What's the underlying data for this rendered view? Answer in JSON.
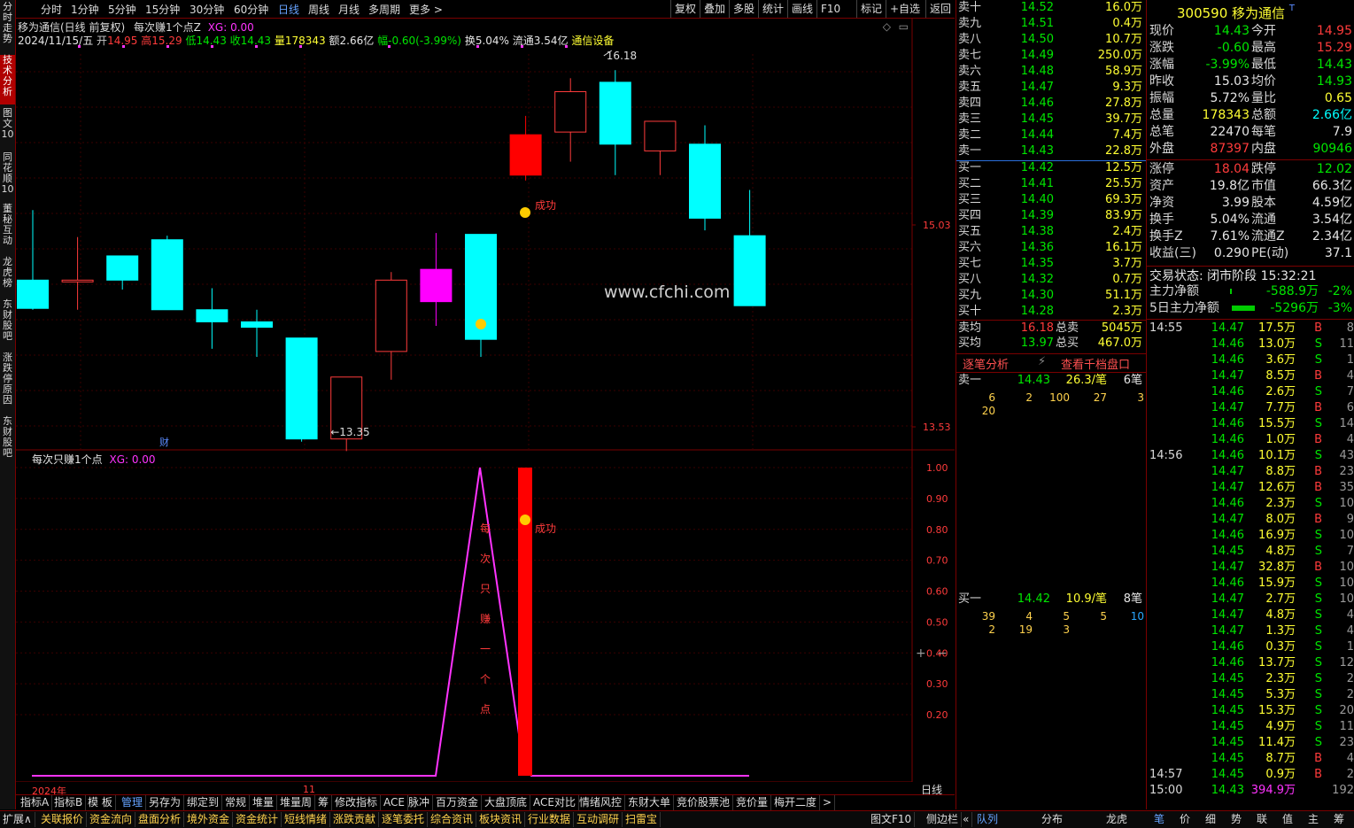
{
  "vtabs": [
    "分时走势",
    "技术分析",
    "图文10",
    "同花顺10",
    "董秘互动",
    "龙虎榜",
    "东财股吧",
    "涨跌停原因",
    "东财股吧"
  ],
  "topbar": {
    "periods": [
      "分时",
      "1分钟",
      "5分钟",
      "15分钟",
      "30分钟",
      "60分钟",
      "日线",
      "周线",
      "月线",
      "多周期",
      "更多 >"
    ],
    "active_period": "日线",
    "right_buttons": [
      "复权",
      "叠加",
      "多股",
      "统计",
      "画线",
      "F10",
      "标记",
      "+自选",
      "返回"
    ]
  },
  "chart_header": {
    "title": "移为通信(日线 前复权)",
    "indicator": "每次赚1个点Z",
    "xg": "XG: 0.00",
    "date": "2024/11/15/五",
    "open_label": "开",
    "open": "14.95",
    "high_label": "高",
    "high": "15.29",
    "low_label": "低",
    "low": "14.43",
    "close_label": "收",
    "close": "14.43",
    "vol_label": "量",
    "vol": "178343",
    "amt_label": "额",
    "amt": "2.66亿",
    "chg_label": "幅",
    "chg": "-0.60(-3.99%)",
    "turn_label": "换",
    "turn": "5.04%",
    "float_label": "流通",
    "float": "3.54亿",
    "sector": "通信设备"
  },
  "chart_data": {
    "type": "candlestick",
    "price_axis": {
      "ticks": [
        "15.03",
        "13.53"
      ]
    },
    "candles": [
      {
        "o": 14.62,
        "h": 15.14,
        "l": 14.4,
        "c": 14.41
      },
      {
        "o": 14.62,
        "h": 14.94,
        "l": 14.4,
        "c": 14.62
      },
      {
        "o": 14.8,
        "h": 14.8,
        "l": 14.55,
        "c": 14.62
      },
      {
        "o": 14.92,
        "h": 14.95,
        "l": 14.4,
        "c": 14.4
      },
      {
        "o": 14.4,
        "h": 14.56,
        "l": 14.11,
        "c": 14.31
      },
      {
        "o": 14.31,
        "h": 14.4,
        "l": 14.05,
        "c": 14.27
      },
      {
        "o": 14.19,
        "h": 14.19,
        "l": 13.42,
        "c": 13.44
      },
      {
        "o": 13.44,
        "h": 13.9,
        "l": 13.35,
        "c": 13.9
      },
      {
        "o": 14.09,
        "h": 14.68,
        "l": 13.88,
        "c": 14.62
      },
      {
        "o": 14.7,
        "h": 14.97,
        "l": 14.28,
        "c": 14.46
      },
      {
        "o": 14.96,
        "h": 14.96,
        "l": 14.05,
        "c": 14.18
      },
      {
        "o": 15.4,
        "h": 15.84,
        "l": 15.36,
        "c": 15.7
      },
      {
        "o": 15.72,
        "h": 16.12,
        "l": 15.5,
        "c": 16.02
      },
      {
        "o": 16.09,
        "h": 16.18,
        "l": 15.4,
        "c": 15.63
      },
      {
        "o": 15.58,
        "h": 15.6,
        "l": 15.4,
        "c": 15.8
      },
      {
        "o": 15.63,
        "h": 15.77,
        "l": 14.99,
        "c": 15.08
      },
      {
        "o": 14.95,
        "h": 15.29,
        "l": 14.43,
        "c": 14.43
      }
    ],
    "high_mark": "16.18",
    "low_mark": "13.35",
    "success_label": "成功",
    "watermark": "www.cfchi.com",
    "fin_badge": "财",
    "sub": {
      "title": "每次只赚1个点",
      "xg": "XG: 0.00",
      "y_ticks": [
        "1.00",
        "0.90",
        "0.80",
        "0.70",
        "0.60",
        "0.50",
        "0.40",
        "0.30",
        "0.20"
      ],
      "vertical_text": [
        "每",
        "次",
        "只",
        "赚",
        "一",
        "个",
        "点"
      ],
      "success_label": "成功"
    },
    "x_labels": [
      "2024年",
      "11"
    ],
    "period_label": "日线"
  },
  "quote": {
    "code": "300590",
    "name": "移为通信",
    "asks": [
      {
        "l": "卖十",
        "p": "14.52",
        "v": "16.0万"
      },
      {
        "l": "卖九",
        "p": "14.51",
        "v": "0.4万"
      },
      {
        "l": "卖八",
        "p": "14.50",
        "v": "10.7万"
      },
      {
        "l": "卖七",
        "p": "14.49",
        "v": "250.0万"
      },
      {
        "l": "卖六",
        "p": "14.48",
        "v": "58.9万"
      },
      {
        "l": "卖五",
        "p": "14.47",
        "v": "9.3万"
      },
      {
        "l": "卖四",
        "p": "14.46",
        "v": "27.8万"
      },
      {
        "l": "卖三",
        "p": "14.45",
        "v": "39.7万"
      },
      {
        "l": "卖二",
        "p": "14.44",
        "v": "7.4万"
      },
      {
        "l": "卖一",
        "p": "14.43",
        "v": "22.8万"
      }
    ],
    "bids": [
      {
        "l": "买一",
        "p": "14.42",
        "v": "12.5万"
      },
      {
        "l": "买二",
        "p": "14.41",
        "v": "25.5万"
      },
      {
        "l": "买三",
        "p": "14.40",
        "v": "69.3万"
      },
      {
        "l": "买四",
        "p": "14.39",
        "v": "83.9万"
      },
      {
        "l": "买五",
        "p": "14.38",
        "v": "2.4万"
      },
      {
        "l": "买六",
        "p": "14.36",
        "v": "16.1万"
      },
      {
        "l": "买七",
        "p": "14.35",
        "v": "3.7万"
      },
      {
        "l": "买八",
        "p": "14.32",
        "v": "0.7万"
      },
      {
        "l": "买九",
        "p": "14.30",
        "v": "51.1万"
      },
      {
        "l": "买十",
        "p": "14.28",
        "v": "2.3万"
      }
    ],
    "avg": [
      {
        "l": "卖均",
        "p": "16.18",
        "l2": "总卖",
        "v": "5045万"
      },
      {
        "l": "买均",
        "p": "13.97",
        "l2": "总买",
        "v": "467.0万"
      }
    ],
    "tick_analysis": "逐笔分析",
    "queue_link": "查看千档盘口",
    "sell1_queue": {
      "label": "卖一",
      "price": "14.43",
      "avg": "26.3/笔",
      "count": "6笔",
      "rows": [
        [
          "6",
          "2",
          "100",
          "27",
          "3"
        ],
        [
          "20"
        ]
      ]
    },
    "buy1_queue": {
      "label": "买一",
      "price": "14.42",
      "avg": "10.9/笔",
      "count": "8笔",
      "rows": [
        [
          "39",
          "4",
          "5",
          "5",
          "10"
        ],
        [
          "2",
          "19",
          "3"
        ]
      ]
    },
    "stats": [
      {
        "a": "现价",
        "av": "14.43",
        "b": "今开",
        "bv": "14.95",
        "ac": "grn",
        "bc": "red"
      },
      {
        "a": "涨跌",
        "av": "-0.60",
        "b": "最高",
        "bv": "15.29",
        "ac": "grn",
        "bc": "red"
      },
      {
        "a": "涨幅",
        "av": "-3.99%",
        "b": "最低",
        "bv": "14.43",
        "ac": "grn",
        "bc": "grn"
      },
      {
        "a": "昨收",
        "av": "15.03",
        "b": "均价",
        "bv": "14.93",
        "ac": "wht",
        "bc": "grn"
      },
      {
        "a": "振幅",
        "av": "5.72%",
        "b": "量比",
        "bv": "0.65",
        "ac": "wht",
        "bc": "yel"
      },
      {
        "a": "总量",
        "av": "178343",
        "b": "总额",
        "bv": "2.66亿",
        "ac": "yel",
        "bc": "cyan"
      },
      {
        "a": "总笔",
        "av": "22470",
        "b": "每笔",
        "bv": "7.9",
        "ac": "wht",
        "bc": "wht"
      },
      {
        "a": "外盘",
        "av": "87397",
        "b": "内盘",
        "bv": "90946",
        "ac": "red",
        "bc": "grn"
      }
    ],
    "stats2": [
      {
        "a": "涨停",
        "av": "18.04",
        "b": "跌停",
        "bv": "12.02",
        "ac": "red",
        "bc": "grn"
      },
      {
        "a": "资产",
        "av": "19.8亿",
        "b": "市值",
        "bv": "66.3亿",
        "ac": "wht",
        "bc": "wht"
      },
      {
        "a": "净资",
        "av": "3.99",
        "b": "股本",
        "bv": "4.59亿",
        "ac": "wht",
        "bc": "wht"
      },
      {
        "a": "换手",
        "av": "5.04%",
        "b": "流通",
        "bv": "3.54亿",
        "ac": "wht",
        "bc": "wht"
      },
      {
        "a": "换手Z",
        "av": "7.61%",
        "b": "流通Z",
        "bv": "2.34亿",
        "ac": "wht",
        "bc": "wht"
      },
      {
        "a": "收益(三)",
        "av": "0.290",
        "b": "PE(动)",
        "bv": "37.1",
        "ac": "wht",
        "bc": "wht"
      }
    ],
    "trade_status_label": "交易状态:",
    "trade_status": "闭市阶段 15:32:21",
    "net_flow": [
      {
        "l": "主力净额",
        "v": "-588.9万",
        "p": "-2%"
      },
      {
        "l": "5日主力净额",
        "v": "-5296万",
        "p": "-3%"
      }
    ]
  },
  "ticks": [
    {
      "t": "14:55",
      "p": "14.47",
      "v": "17.5万",
      "s": "B",
      "n": "8"
    },
    {
      "t": "",
      "p": "14.46",
      "v": "13.0万",
      "s": "S",
      "n": "11"
    },
    {
      "t": "",
      "p": "14.46",
      "v": "3.6万",
      "s": "S",
      "n": "1"
    },
    {
      "t": "",
      "p": "14.47",
      "v": "8.5万",
      "s": "B",
      "n": "4"
    },
    {
      "t": "",
      "p": "14.46",
      "v": "2.6万",
      "s": "S",
      "n": "7"
    },
    {
      "t": "",
      "p": "14.47",
      "v": "7.7万",
      "s": "B",
      "n": "6"
    },
    {
      "t": "",
      "p": "14.46",
      "v": "15.5万",
      "s": "S",
      "n": "14"
    },
    {
      "t": "",
      "p": "14.46",
      "v": "1.0万",
      "s": "B",
      "n": "4"
    },
    {
      "t": "14:56",
      "p": "14.46",
      "v": "10.1万",
      "s": "S",
      "n": "43"
    },
    {
      "t": "",
      "p": "14.47",
      "v": "8.8万",
      "s": "B",
      "n": "23"
    },
    {
      "t": "",
      "p": "14.47",
      "v": "12.6万",
      "s": "B",
      "n": "35"
    },
    {
      "t": "",
      "p": "14.46",
      "v": "2.3万",
      "s": "S",
      "n": "10"
    },
    {
      "t": "",
      "p": "14.47",
      "v": "8.0万",
      "s": "B",
      "n": "9"
    },
    {
      "t": "",
      "p": "14.46",
      "v": "16.9万",
      "s": "S",
      "n": "10"
    },
    {
      "t": "",
      "p": "14.45",
      "v": "4.8万",
      "s": "S",
      "n": "7"
    },
    {
      "t": "",
      "p": "14.47",
      "v": "32.8万",
      "s": "B",
      "n": "10"
    },
    {
      "t": "",
      "p": "14.46",
      "v": "15.9万",
      "s": "S",
      "n": "10"
    },
    {
      "t": "",
      "p": "14.47",
      "v": "2.7万",
      "s": "S",
      "n": "10"
    },
    {
      "t": "",
      "p": "14.47",
      "v": "4.8万",
      "s": "S",
      "n": "4"
    },
    {
      "t": "",
      "p": "14.47",
      "v": "1.3万",
      "s": "S",
      "n": "4"
    },
    {
      "t": "",
      "p": "14.46",
      "v": "0.3万",
      "s": "S",
      "n": "1"
    },
    {
      "t": "",
      "p": "14.46",
      "v": "13.7万",
      "s": "S",
      "n": "12"
    },
    {
      "t": "",
      "p": "14.45",
      "v": "2.3万",
      "s": "S",
      "n": "2"
    },
    {
      "t": "",
      "p": "14.45",
      "v": "5.3万",
      "s": "S",
      "n": "2"
    },
    {
      "t": "",
      "p": "14.45",
      "v": "15.3万",
      "s": "S",
      "n": "20"
    },
    {
      "t": "",
      "p": "14.45",
      "v": "4.9万",
      "s": "S",
      "n": "11"
    },
    {
      "t": "",
      "p": "14.45",
      "v": "11.4万",
      "s": "S",
      "n": "23"
    },
    {
      "t": "",
      "p": "14.45",
      "v": "8.7万",
      "s": "B",
      "n": "4"
    },
    {
      "t": "14:57",
      "p": "14.45",
      "v": "0.9万",
      "s": "B",
      "n": "2"
    },
    {
      "t": "15:00",
      "p": "14.43",
      "v": "394.9万",
      "s": "",
      "n": "192"
    }
  ],
  "bottom_tabs": [
    "指标A",
    "指标B",
    "模 板",
    "管理",
    "另存为",
    "绑定到",
    "常规",
    "堆量",
    "堆量周",
    "筹",
    "修改指标",
    "ACE",
    "脉冲",
    "百万资金",
    "大盘顶底",
    "ACE对比",
    "情绪风控",
    "东财大单",
    "竞价股票池",
    "竞价量",
    "梅开二度",
    ">"
  ],
  "bottom_tabs_active": "管理",
  "status_tabs": [
    "扩展∧",
    "关联报价",
    "资金流向",
    "盘面分析",
    "境外资金",
    "资金统计",
    "短线情绪",
    "涨跌贡献",
    "逐笔委托",
    "综合资讯",
    "板块资讯",
    "行业数据",
    "互动调研",
    "扫雷宝"
  ],
  "status_right": [
    "图文F10",
    "侧边栏",
    "«"
  ],
  "mid_tabs": [
    "队列",
    "分布",
    "龙虎"
  ],
  "right_tabs": [
    "笔",
    "价",
    "细",
    "势",
    "联",
    "值",
    "主",
    "筹"
  ]
}
